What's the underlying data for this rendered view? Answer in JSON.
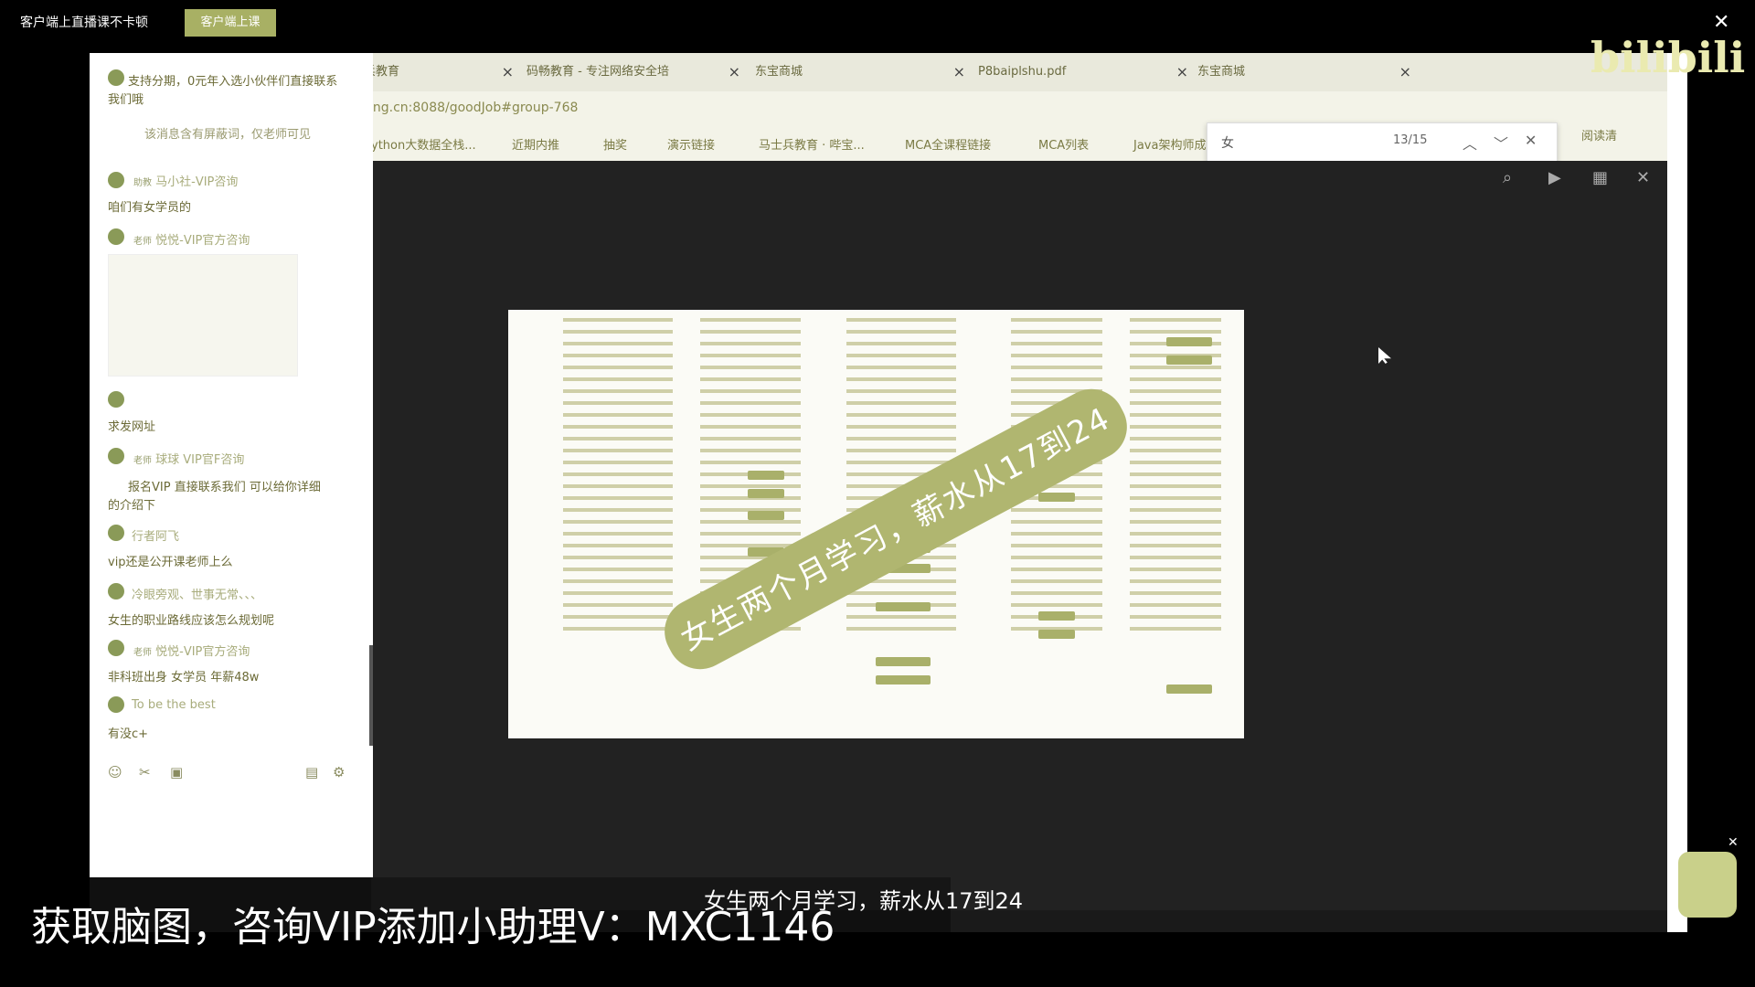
{
  "top": {
    "title": "客户端上直播课不卡顿",
    "button": "客户端上课",
    "close": "✕"
  },
  "tabs": [
    {
      "label": "兵教育"
    },
    {
      "label": "码畅教育 - 专注网络安全培"
    },
    {
      "label": "东宝商城"
    },
    {
      "label": "P8baiplshu.pdf"
    },
    {
      "label": "东宝商城"
    }
  ],
  "address": {
    "url": "ing.cn:8088/goodJob#group-768"
  },
  "bookmarks": [
    "ython大数据全栈...",
    "近期内推",
    "抽奖",
    "演示链接",
    "马士兵教育 · 哔宝...",
    "MCA全课程链接",
    "MCA列表",
    "Java架构师成"
  ],
  "find": {
    "query": "女",
    "count": "13/15"
  },
  "reader": "阅读清",
  "chat": {
    "notice": "该消息含有屏蔽词，仅老师可见",
    "items": [
      {
        "name": "",
        "msg": "支持分期，0元年入选小伙伴们直接联系"
      },
      {
        "name": "",
        "msg": "我们哦"
      },
      {
        "name": "马小社-VIP咨询",
        "tag": "助教",
        "msg": "咱们有女学员的"
      },
      {
        "name": "悦悦-VIP官方咨询",
        "tag": "老师",
        "msg": ""
      },
      {
        "name": "",
        "msg": "求发网址"
      },
      {
        "name": "球球 VIP官F咨询",
        "tag": "老师",
        "msg": "报名VIP  直接联系我们  可以给你详细"
      },
      {
        "name": "",
        "msg": "的介绍下"
      },
      {
        "name": "行者阿飞",
        "msg": "vip还是公开课老师上么"
      },
      {
        "name": "冷眼旁观、世事无常、、、",
        "msg": "女生的职业路线应该怎么规划呢"
      },
      {
        "name": "悦悦-VIP官方咨询",
        "tag": "老师",
        "msg": "非科班出身 女学员 年薪48w"
      },
      {
        "name": "To be the best",
        "msg": "有没c+"
      }
    ]
  },
  "shot": {
    "banner": "女生两个月学习，薪水从17到24"
  },
  "subtitles": {
    "small": "女生两个月学习，薪水从17到24",
    "main": "获取脑图，咨询VIP添加小助理V：MXC1146"
  },
  "logo": "bilibili",
  "icons": {
    "search": "search-icon",
    "play": "play-icon",
    "grid": "grid-icon",
    "close": "close-icon"
  }
}
